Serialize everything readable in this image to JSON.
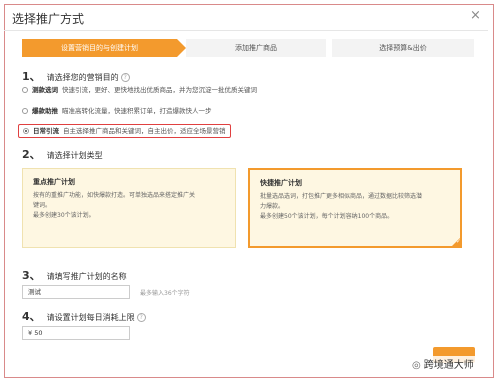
{
  "dialog": {
    "title": "选择推广方式",
    "close": "×"
  },
  "steps": [
    {
      "label": "设置营销目的与创建计划"
    },
    {
      "label": "添加推广商品"
    },
    {
      "label": "选择预算&出价"
    }
  ],
  "section1": {
    "num": "1、",
    "label": "请选择您的营销目的",
    "help": "?",
    "options": [
      {
        "title": "测款选词",
        "desc": "快速引流，更好、更快地找出优质商品，并为您沉淀一批优质关键词",
        "selected": false
      },
      {
        "title": "爆款助推",
        "desc": "瞄准高转化流量，快速积累订单，打造爆款快人一步",
        "selected": false
      },
      {
        "title": "日常引流",
        "desc": "自主选择推广商品和关键词，自主出价，适应全场景营销",
        "selected": true
      }
    ]
  },
  "section2": {
    "num": "2、",
    "label": "请选择计划类型",
    "cards": [
      {
        "title": "重点推广计划",
        "lines": [
          "按有的重推广功能，如快爆款打造。可单独选品来搭定推广关",
          "键词。",
          "最多创建30个该计划。"
        ]
      },
      {
        "title": "快捷推广计划",
        "lines": [
          "批量选品选词，打包推广更多相似商品，通过数据比较筛选潜",
          "力爆款。",
          "最多创建50个该计划，每个计划容纳100个商品。"
        ]
      }
    ]
  },
  "section3": {
    "num": "3、",
    "label": "请填写推广计划的名称",
    "value": "测试",
    "hint": "最多输入36个字符"
  },
  "section4": {
    "num": "4、",
    "label": "请设置计划每日消耗上限",
    "help": "?",
    "value": "¥  50"
  },
  "watermark": {
    "icon": "◎",
    "text": "跨境通大师"
  }
}
